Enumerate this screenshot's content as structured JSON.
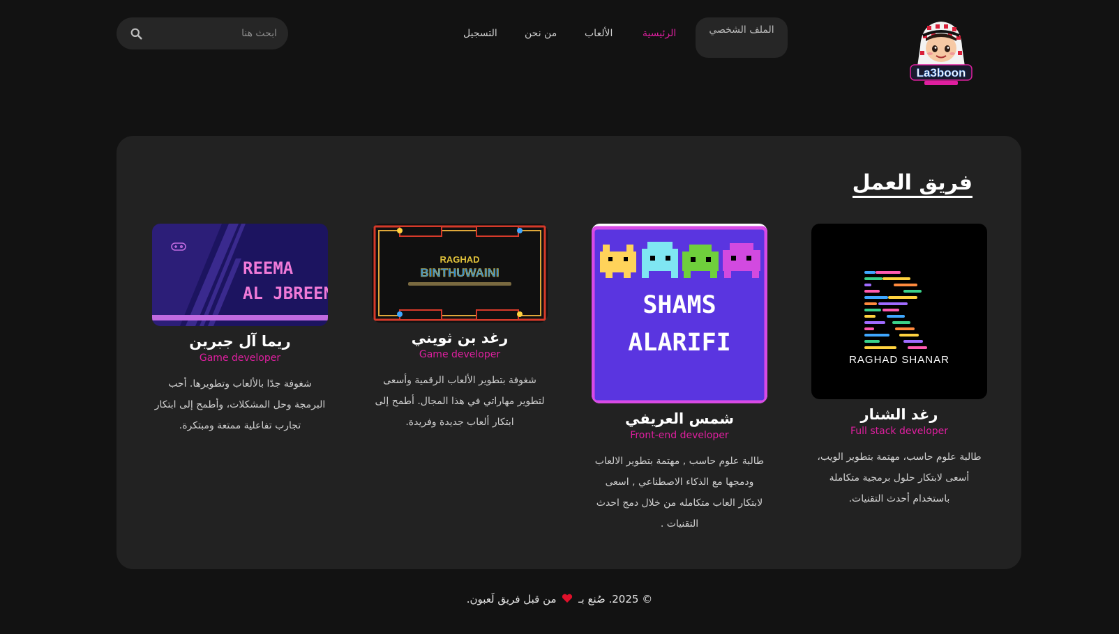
{
  "header": {
    "logo_alt": "La3boon",
    "profile_label": "الملف الشخصي",
    "nav": [
      {
        "label": "الرئيسية",
        "active": true
      },
      {
        "label": "الألعاب",
        "active": false
      },
      {
        "label": "من نحن",
        "active": false
      },
      {
        "label": "التسجيل",
        "active": false
      }
    ],
    "search": {
      "placeholder": "ابحث هنا",
      "icon": "search-icon"
    }
  },
  "team": {
    "title": "فريق العمل",
    "members": [
      {
        "name": "رغد الشنار",
        "role": "Full stack developer",
        "bio": "طالبة علوم حاسب، مهتمة بتطوير الويب، أسعى لابتكار حلول برمجية متكاملة باستخدام أحدث التقنيات.",
        "image_text": "RAGHAD SHANAR"
      },
      {
        "name": "شمس العريفي",
        "role": "Front-end developer",
        "bio": "طالبة علوم حاسب , مهتمة بتطوير الالعاب ودمجها مع الذكاء الاصطناعي , اسعى لابتكار العاب متكامله من خلال دمج احدث التقنيات .",
        "image_text_1": "SHAMS",
        "image_text_2": "ALARIFI"
      },
      {
        "name": "رغد بن ثويني",
        "role": "Game developer",
        "bio": "شغوفة بتطوير الألعاب الرقمية وأسعى لتطوير مهاراتي في هذا المجال. أطمح إلى ابتكار ألعاب جديدة وفريدة.",
        "image_text_1": "RAGHAD",
        "image_text_2": "BINTHUWAINI"
      },
      {
        "name": "ريما آل جبرين",
        "role": "Game developer",
        "bio": "شغوفة جدًا بالألعاب وتطويرها. أحب البرمجة وحل المشكلات، وأطمح إلى ابتكار تجارب تفاعلية ممتعة ومبتكرة.",
        "image_text_1": "REEMA",
        "image_text_2": "AL JBREEN"
      }
    ]
  },
  "footer": {
    "before_heart": "© 2025. صُنع بـ",
    "after_heart": "من قبل فريق لَعبون."
  },
  "colors": {
    "background": "#121212",
    "panel": "#222222",
    "accent": "#e01fa0",
    "heart": "#e0102a"
  }
}
